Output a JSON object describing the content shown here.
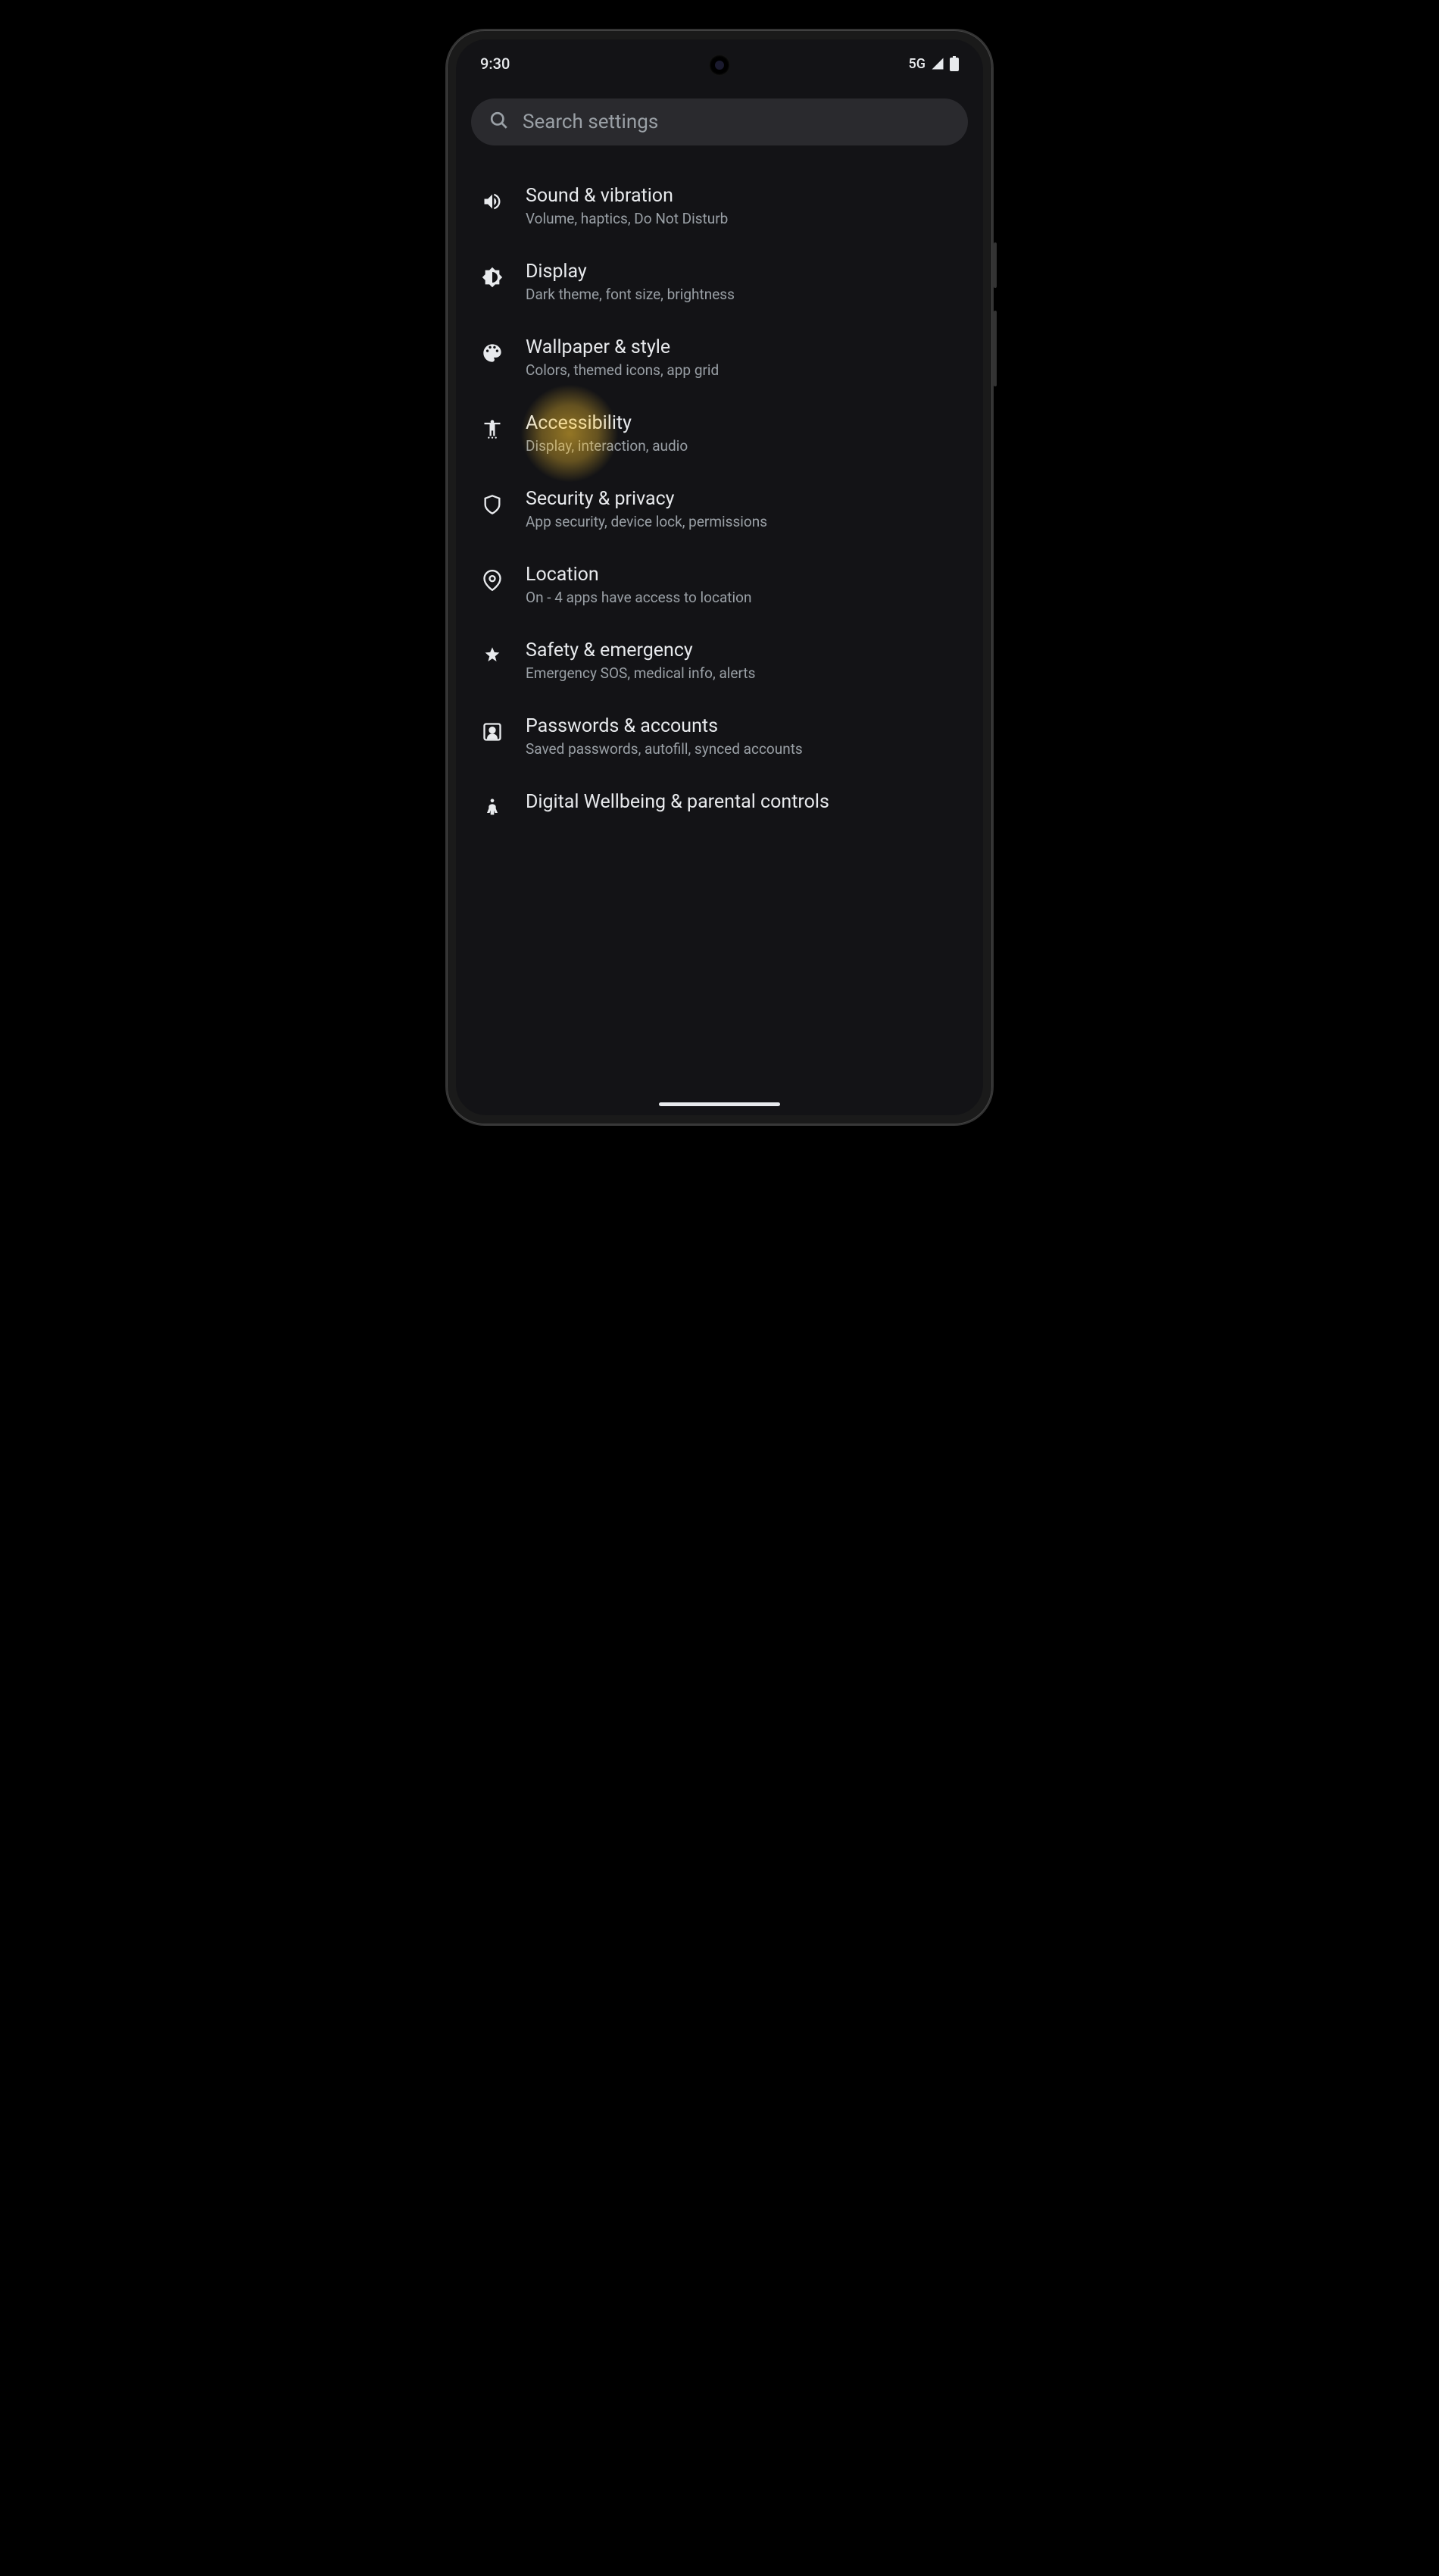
{
  "status": {
    "time": "9:30",
    "network": "5G"
  },
  "search": {
    "placeholder": "Search settings"
  },
  "settings": [
    {
      "icon": "volume",
      "title": "Sound & vibration",
      "subtitle": "Volume, haptics, Do Not Disturb",
      "highlighted": false
    },
    {
      "icon": "brightness",
      "title": "Display",
      "subtitle": "Dark theme, font size, brightness",
      "highlighted": false
    },
    {
      "icon": "palette",
      "title": "Wallpaper & style",
      "subtitle": "Colors, themed icons, app grid",
      "highlighted": false
    },
    {
      "icon": "accessibility",
      "title": "Accessibility",
      "subtitle": "Display, interaction, audio",
      "highlighted": true
    },
    {
      "icon": "shield",
      "title": "Security & privacy",
      "subtitle": "App security, device lock, permissions",
      "highlighted": false
    },
    {
      "icon": "location",
      "title": "Location",
      "subtitle": "On - 4 apps have access to location",
      "highlighted": false
    },
    {
      "icon": "emergency",
      "title": "Safety & emergency",
      "subtitle": "Emergency SOS, medical info, alerts",
      "highlighted": false
    },
    {
      "icon": "account",
      "title": "Passwords & accounts",
      "subtitle": "Saved passwords, autofill, synced accounts",
      "highlighted": false
    },
    {
      "icon": "wellbeing",
      "title": "Digital Wellbeing & parental controls",
      "subtitle": "",
      "highlighted": false
    }
  ]
}
